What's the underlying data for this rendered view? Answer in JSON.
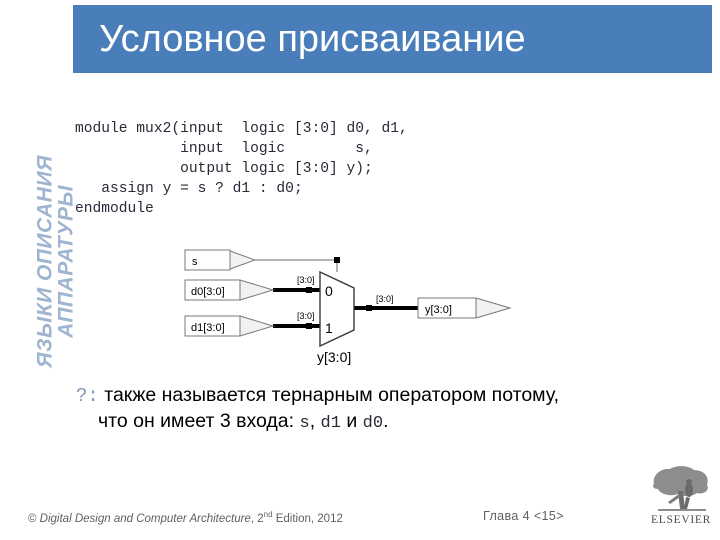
{
  "slide": {
    "title": "Условное присваивание",
    "title_bar_color": "#4a7ebb",
    "sidebar_label": "ЯЗЫКИ ОПИСАНИЯ\nАППАРАТУРЫ",
    "sidebar_label_color": "#9fb4cf"
  },
  "code": {
    "language": "SystemVerilog",
    "text": "module mux2(input  logic [3:0] d0, d1,\n            input  logic        s,\n            output logic [3:0] y);\n   assign y = s ? d1 : d0;\nendmodule",
    "lines": [
      "module mux2(input  logic [3:0] d0, d1,",
      "            input  logic        s,",
      "            output logic [3:0] y);",
      "   assign y = s ? d1 : d0;",
      "endmodule"
    ]
  },
  "circuit": {
    "caption": "y[3:0]",
    "inputs": [
      {
        "label": "s",
        "bus": ""
      },
      {
        "label": "d0[3:0]",
        "bus": "[3:0]"
      },
      {
        "label": "d1[3:0]",
        "bus": "[3:0]"
      }
    ],
    "mux": {
      "port_0": "0",
      "port_1": "1",
      "label": "y[3:0]"
    },
    "output": {
      "label": "y[3:0]",
      "bus": "[3:0]"
    }
  },
  "bullet": {
    "marker": "?:",
    "line1_text": " также называется тернарным оператором потому,",
    "line2_prefix": "что он имеет 3 входа: ",
    "line2_mono_a": "s",
    "line2_sep": ", ",
    "line2_mono_b": "d1",
    "line2_and": " и ",
    "line2_mono_c": "d0",
    "line2_end": "."
  },
  "footer": {
    "copyright_symbol": "© ",
    "copyright_title": "Digital Design and Computer Architecture",
    "copyright_rest_a": ", 2",
    "copyright_ordinal": "nd",
    "copyright_rest_b": " Edition, 2012",
    "chapter": "Глава 4 <15>",
    "logo_wordmark": "ELSEVIER",
    "logo_name": "elsevier-tree-logo"
  }
}
